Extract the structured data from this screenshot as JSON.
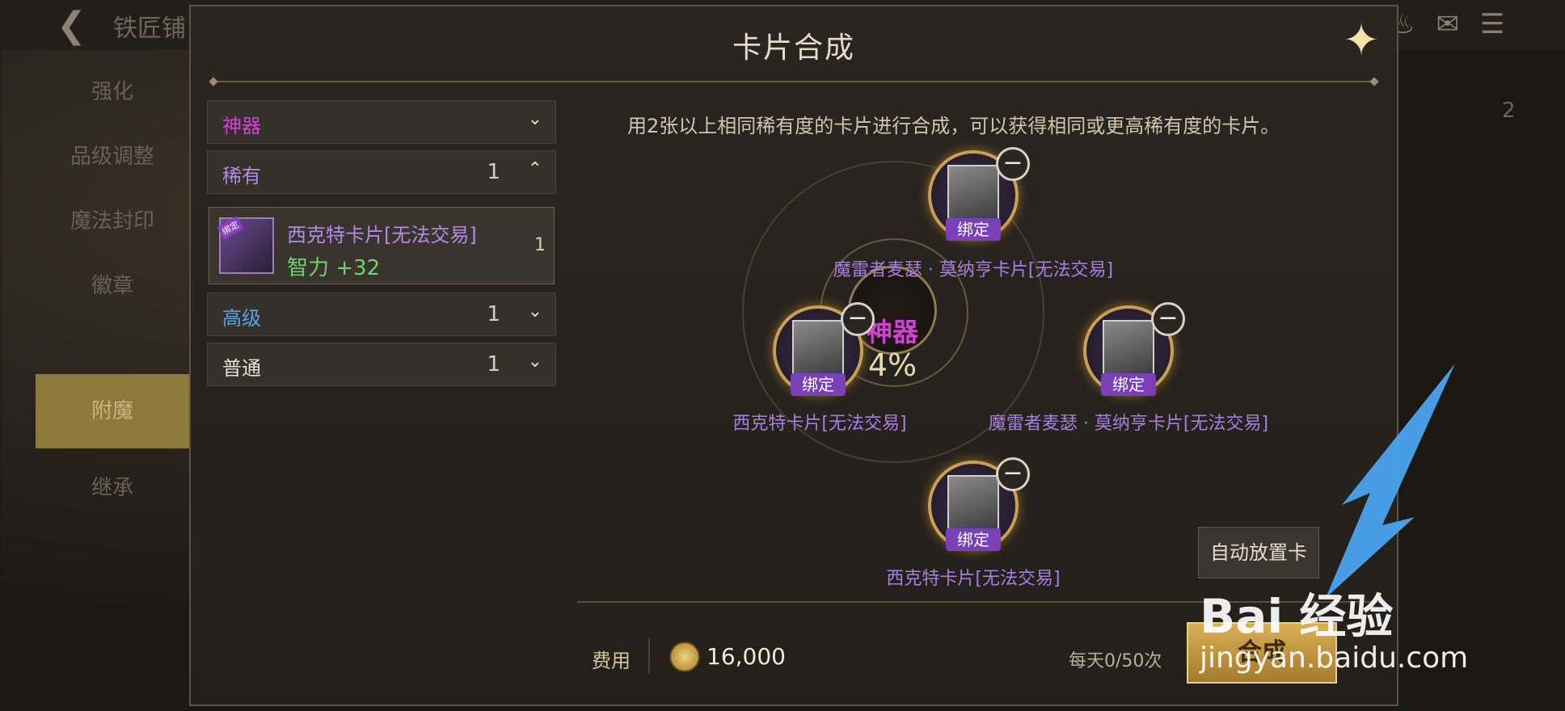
{
  "background": {
    "title": "铁匠铺",
    "nav": [
      "强化",
      "品级调整",
      "魔法封印",
      "徽章",
      "附魔",
      "继承"
    ],
    "nav_active": "附魔",
    "right_num": "2"
  },
  "dialog": {
    "title": "卡片合成",
    "close_icon": "close-x-icon"
  },
  "list": {
    "groups": [
      {
        "label": "神器",
        "count": "",
        "color": "#d143d6",
        "expanded": false
      },
      {
        "label": "稀有",
        "count": "1",
        "color": "#b48ae2",
        "expanded": true
      },
      {
        "label": "高级",
        "count": "1",
        "color": "#5aa0e8",
        "expanded": false
      },
      {
        "label": "普通",
        "count": "1",
        "color": "#e8e2d4",
        "expanded": false
      }
    ],
    "card": {
      "name": "西克特卡片[无法交易]",
      "stat": "智力 +32",
      "qty": "1",
      "tag": "绑定"
    }
  },
  "compose": {
    "description": "用2张以上相同稀有度的卡片进行合成，可以获得相同或更高稀有度的卡片。",
    "center_label": "神器",
    "center_pct": "4%",
    "slots": [
      {
        "name": "魔雷者麦瑟 · 莫纳亨卡片[无法交易]",
        "bind": "绑定"
      },
      {
        "name": "西克特卡片[无法交易]",
        "bind": "绑定"
      },
      {
        "name": "魔雷者麦瑟 · 莫纳亨卡片[无法交易]",
        "bind": "绑定"
      },
      {
        "name": "西克特卡片[无法交易]",
        "bind": "绑定"
      }
    ]
  },
  "bottom": {
    "fee_label": "费用",
    "fee_value": "16,000",
    "daily": "每天0/50次",
    "auto_button": "自动放置卡",
    "compose_button": "合成"
  },
  "watermark": {
    "main": "Bai 经验",
    "sub": "jingyan.baidu.com"
  },
  "colors": {
    "accent_gold": "#c7a055",
    "rare_purple": "#b48ae2",
    "artifact_magenta": "#d143d6",
    "stat_green": "#71d36e"
  }
}
